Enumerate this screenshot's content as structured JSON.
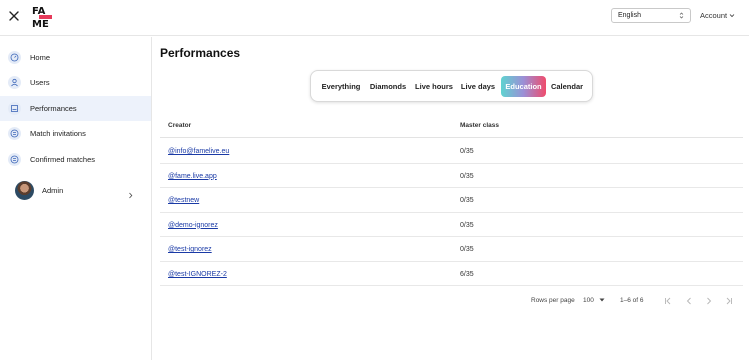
{
  "header": {
    "logo_text": "FA ME",
    "language": "English",
    "account_label": "Account"
  },
  "sidebar": {
    "items": [
      {
        "label": "Home",
        "icon": "speedometer-icon"
      },
      {
        "label": "Users",
        "icon": "user-icon"
      },
      {
        "label": "Performances",
        "icon": "chart-icon",
        "active": true
      },
      {
        "label": "Match invitations",
        "icon": "swap-icon"
      },
      {
        "label": "Confirmed matches",
        "icon": "swap-check-icon"
      }
    ],
    "profile": {
      "name": "Admin"
    }
  },
  "main": {
    "title": "Performances",
    "tabs": [
      {
        "label": "Everything"
      },
      {
        "label": "Diamonds"
      },
      {
        "label": "Live hours"
      },
      {
        "label": "Live days"
      },
      {
        "label": "Education",
        "active": true
      },
      {
        "label": "Calendar"
      }
    ],
    "table": {
      "columns": [
        "Creator",
        "Master class"
      ],
      "rows": [
        {
          "creator": "@info@famelive.eu",
          "master_class": "0/35"
        },
        {
          "creator": "@fame.live.app",
          "master_class": "0/35"
        },
        {
          "creator": "@testnew",
          "master_class": "0/35"
        },
        {
          "creator": "@demo-ignorez",
          "master_class": "0/35"
        },
        {
          "creator": "@test-ignorez",
          "master_class": "0/35"
        },
        {
          "creator": "@test-IGNOREZ-2",
          "master_class": "6/35"
        }
      ]
    },
    "pagination": {
      "rows_per_page_label": "Rows per page",
      "rows_per_page": "100",
      "range": "1–6 of 6"
    }
  },
  "colors": {
    "link": "#1a3aa6",
    "active_nav_bg": "#edf2fb",
    "tab_gradient_start": "#5fd3d0",
    "tab_gradient_end": "#f04c6c"
  }
}
